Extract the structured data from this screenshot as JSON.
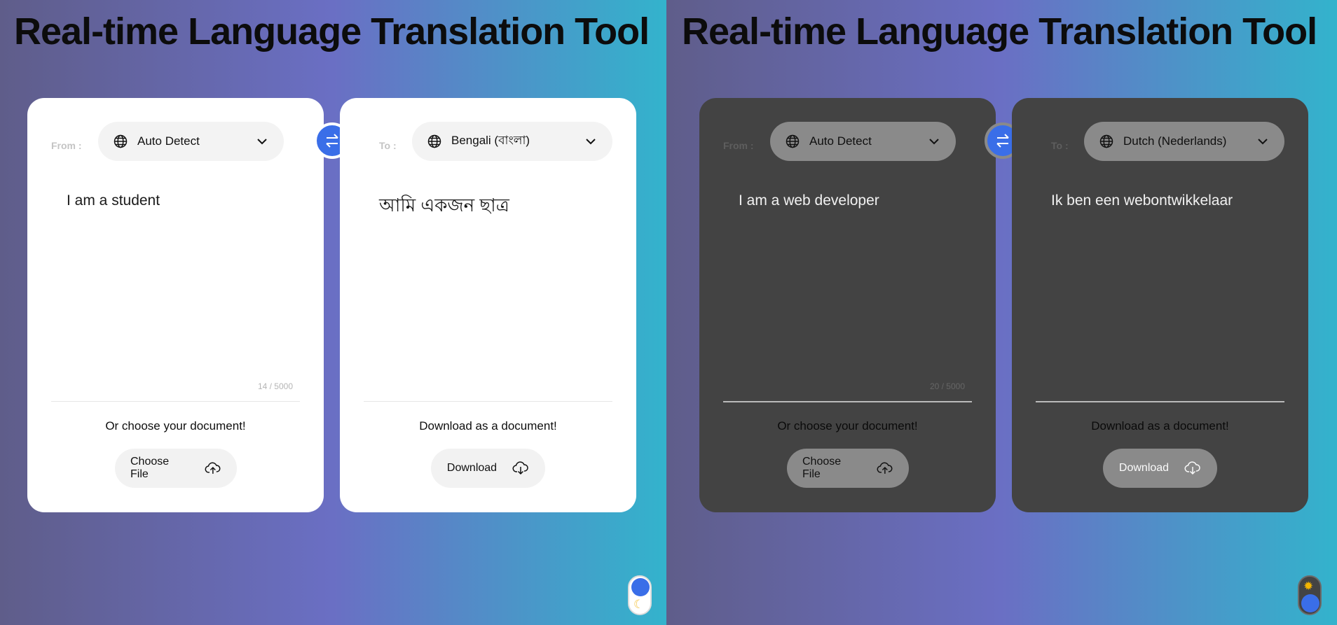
{
  "light": {
    "title": "Real-time Language Translation Tool",
    "from_label": "From :",
    "to_label": "To :",
    "from_lang": "Auto Detect",
    "to_lang": "Bengali (বাংলা)",
    "input_text": "I am a student",
    "output_text": "আমি একজন ছাত্র",
    "char_count": "14 / 5000",
    "upload_hint": "Or choose your document!",
    "download_hint": "Download as a document!",
    "choose_file_label": "Choose File",
    "download_label": "Download",
    "toggle_icon": "moon-icon"
  },
  "dark": {
    "title": "Real-time Language Translation Tool",
    "from_label": "From :",
    "to_label": "To :",
    "from_lang": "Auto Detect",
    "to_lang": "Dutch (Nederlands)",
    "input_text": "I am a web developer",
    "output_text": "Ik ben een webontwikkelaar",
    "char_count": "20 / 5000",
    "upload_hint": "Or choose your document!",
    "download_hint": "Download as a document!",
    "choose_file_label": "Choose File",
    "download_label": "Download",
    "toggle_icon": "sun-icon"
  },
  "colors": {
    "accent": "#3a6ee8",
    "gradient_start": "#5f5d8a",
    "gradient_mid": "#6a6fc4",
    "gradient_end": "#33b3cc",
    "dark_card": "#434343",
    "dark_control": "#8a8a8a"
  }
}
